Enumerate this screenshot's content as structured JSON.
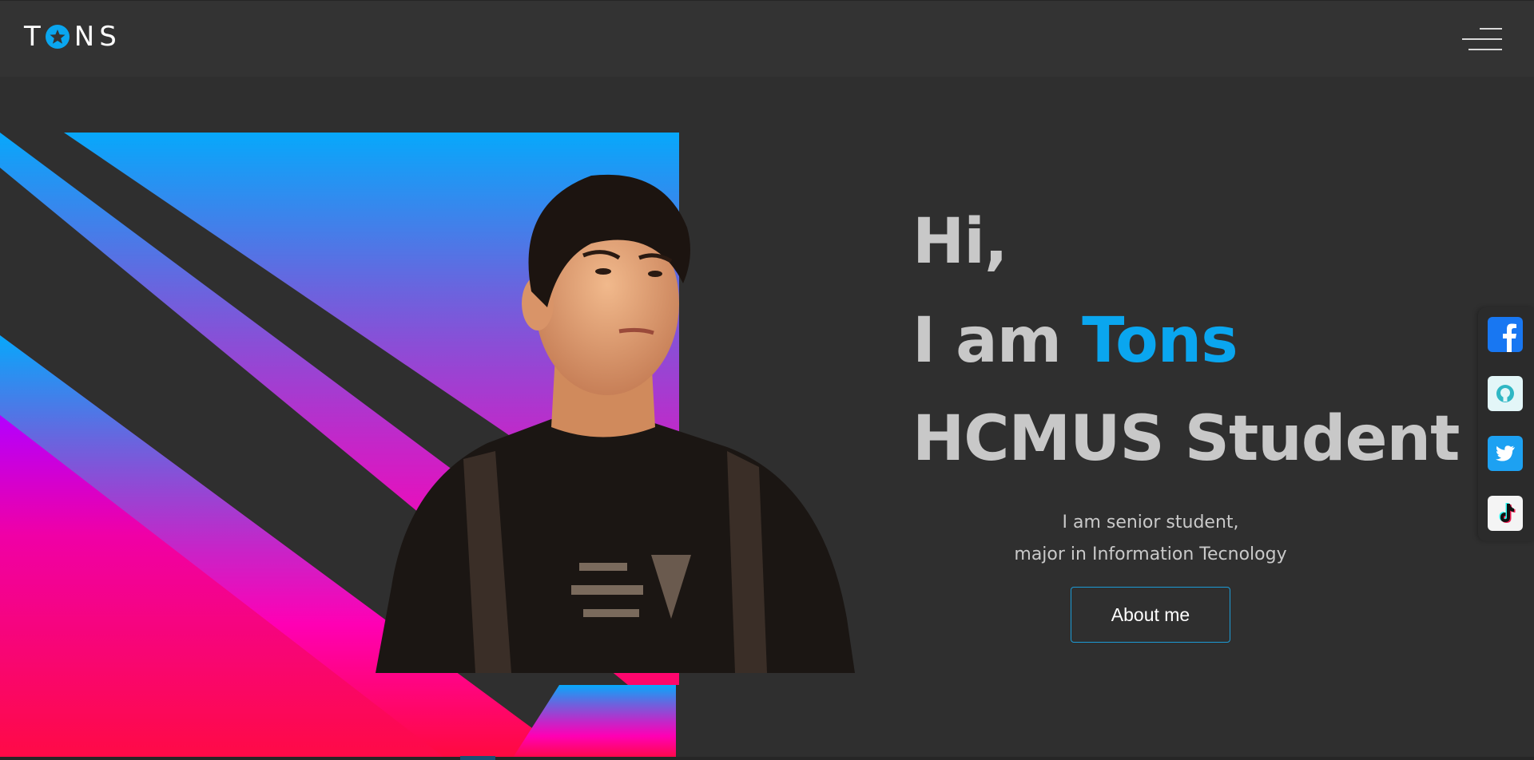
{
  "header": {
    "logo_text_left": "T",
    "logo_text_right": "NS",
    "menu_icon": "hamburger-menu-icon"
  },
  "hero": {
    "line1": "Hi,",
    "line2_prefix": "I am ",
    "line2_name": "Tons",
    "line3": "HCMUS Student",
    "desc_line1": "I am senior student,",
    "desc_line2": "major in Information Tecnology",
    "about_label": "About me"
  },
  "social": {
    "items": [
      {
        "icon": "facebook-icon",
        "color": "#1877f2"
      },
      {
        "icon": "github-icon",
        "color": "#e3f6f8"
      },
      {
        "icon": "twitter-icon",
        "color": "#1da1f2"
      },
      {
        "icon": "tiktok-icon",
        "color": "#f4f4f4"
      }
    ]
  },
  "colors": {
    "accent": "#0aa6ef",
    "background": "#2f2f2f",
    "header": "#333333",
    "gradient_top": "#07a8fb",
    "gradient_mid": "#ff00b4",
    "gradient_bottom": "#ff0a3c"
  }
}
